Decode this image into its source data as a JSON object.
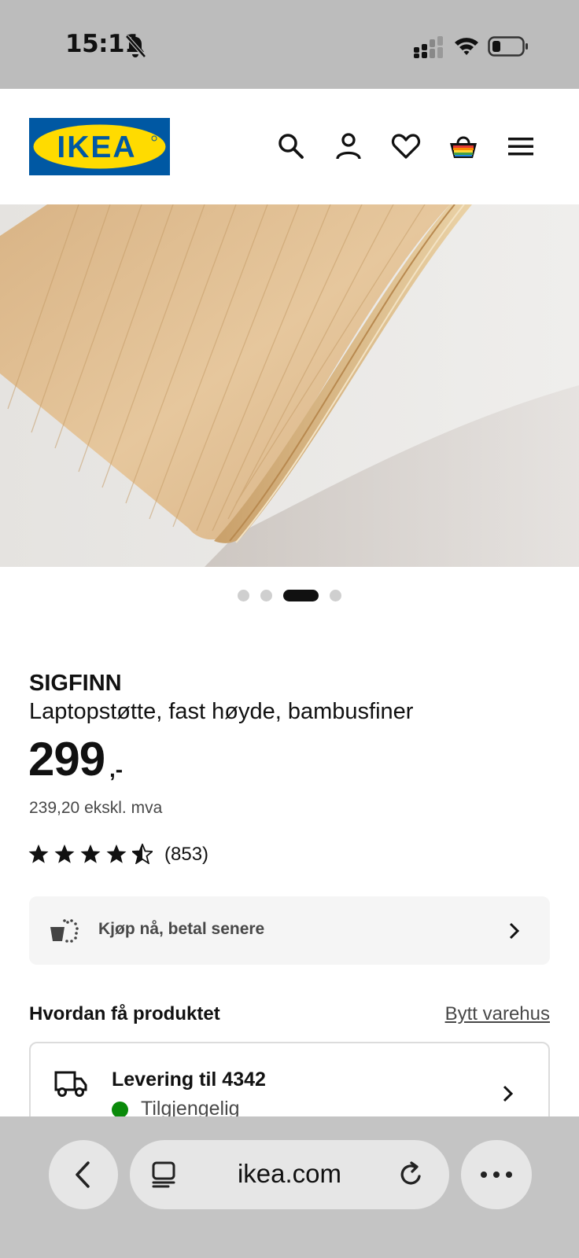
{
  "status_bar": {
    "time": "15:11",
    "icons": [
      "bell-muted-icon",
      "signal-icon",
      "wifi-icon",
      "battery-icon"
    ]
  },
  "header": {
    "logo_text": "IKEA",
    "icons": [
      "search-icon",
      "account-icon",
      "wishlist-heart-icon",
      "basket-icon",
      "menu-icon"
    ],
    "colors": {
      "logo_blue": "#0058a3",
      "logo_yellow": "#ffdb00"
    }
  },
  "gallery": {
    "image": "bamboo laptop stand close-up",
    "dots": 4,
    "active_index": 2
  },
  "product": {
    "brand": "SIGFINN",
    "description": "Laptopstøtte, fast høyde, bambusfiner",
    "price": "299",
    "price_suffix": ",-",
    "price_excl": "239,20 ekskl. mva",
    "rating_stars": 4.5,
    "rating_count": "(853)"
  },
  "pay_later": {
    "label": "Kjøp nå, betal senere",
    "icon": "pay-later-icon"
  },
  "how_to_get": {
    "heading": "Hvordan få produktet",
    "change_store": "Bytt varehus",
    "delivery": {
      "title": "Levering til 4342",
      "availability": "Tilgjengelig",
      "status_color": "#0a8a0a"
    }
  },
  "browser": {
    "url": "ikea.com",
    "icons": [
      "back-icon",
      "tabs-icon",
      "reload-icon",
      "more-icon"
    ]
  }
}
